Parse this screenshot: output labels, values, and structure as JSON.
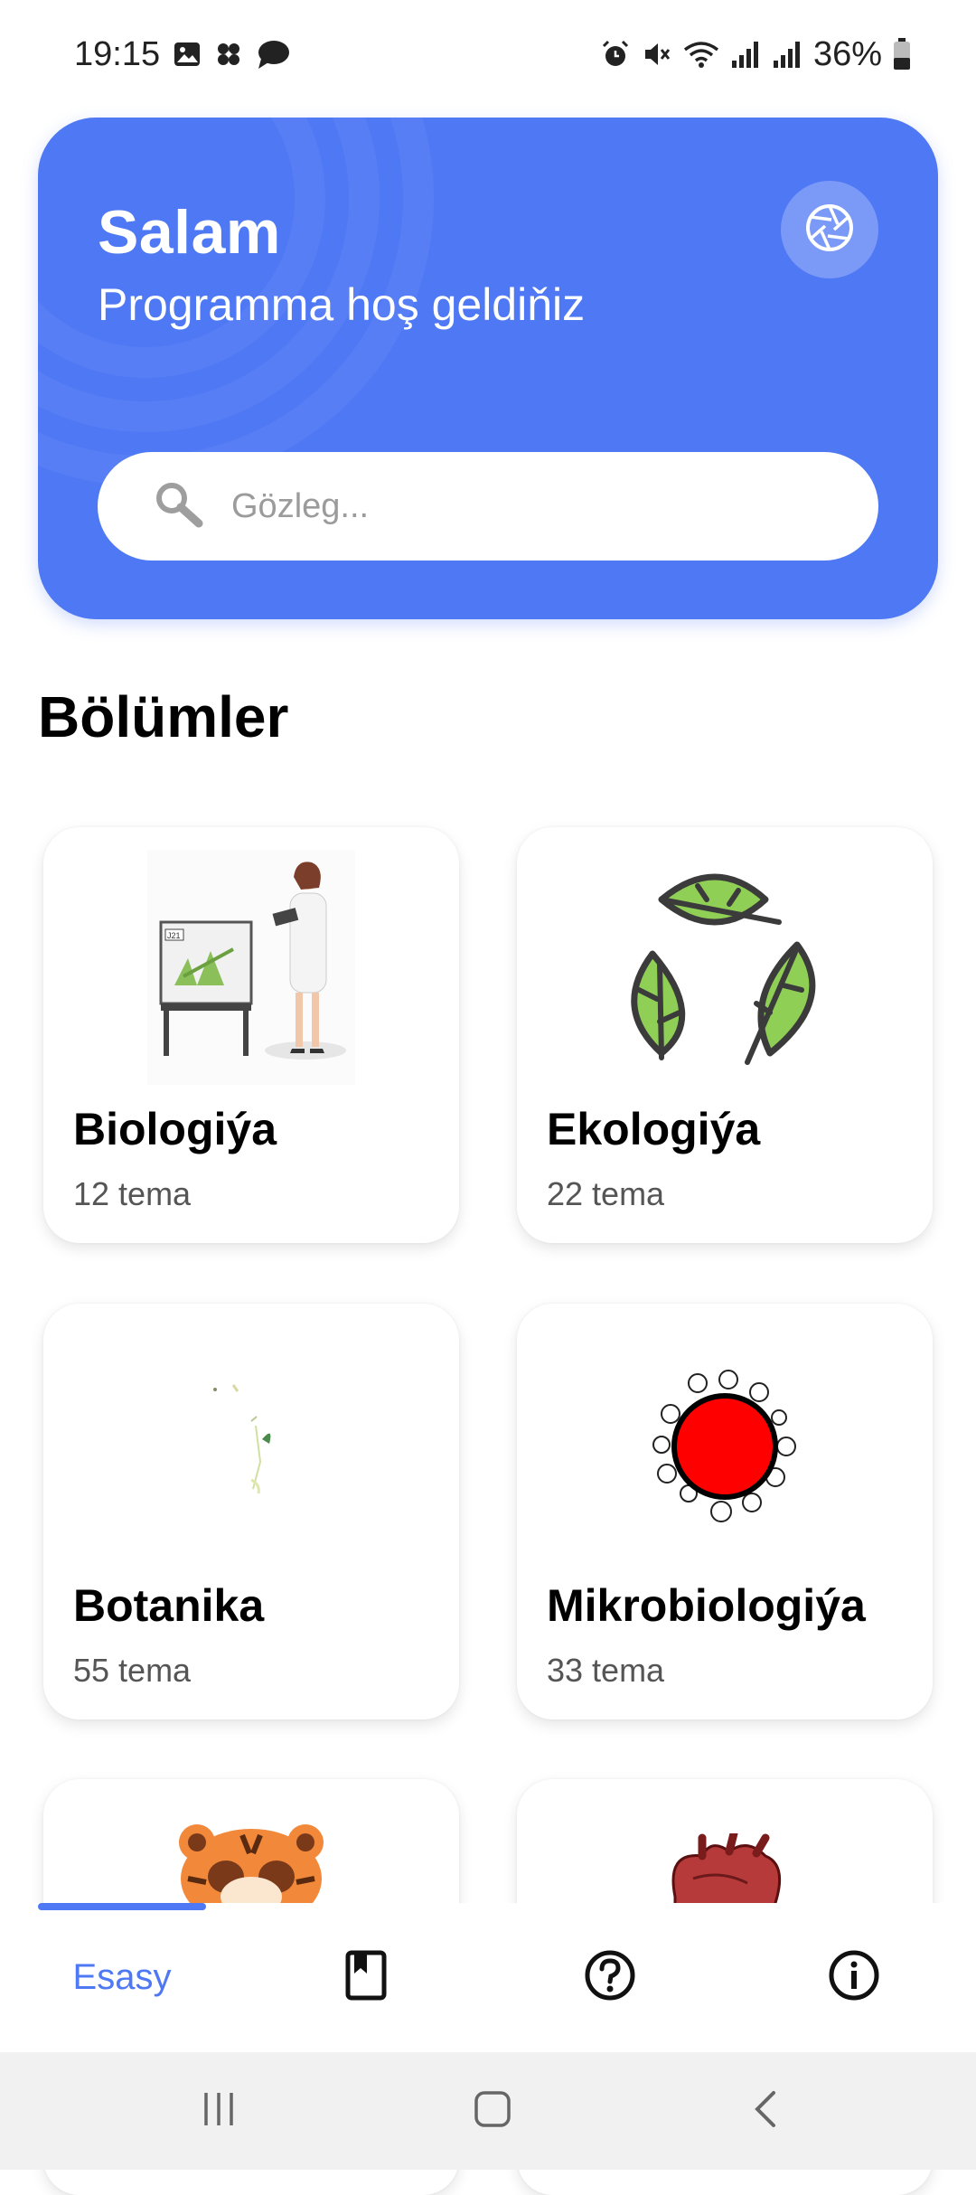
{
  "status_bar": {
    "time": "19:15",
    "battery": "36%",
    "left_icons": [
      "gallery-icon",
      "pinwheel-icon",
      "chat-bubble-icon"
    ],
    "right_icons": [
      "alarm-icon",
      "mute-icon",
      "wifi-icon",
      "signal-icon",
      "signal-icon",
      "battery-icon"
    ]
  },
  "header": {
    "title": "Salam",
    "subtitle": "Programma hoş geldiňiz",
    "settings_icon": "aperture-icon",
    "accent_color": "#4f78f4",
    "search": {
      "placeholder": "Gözleg...",
      "value": ""
    }
  },
  "section": {
    "title": "Bölümler"
  },
  "categories": [
    {
      "title": "Biologiýa",
      "count": "12 tema",
      "icon": "scientist-illustration"
    },
    {
      "title": "Ekologiýa",
      "count": "22 tema",
      "icon": "recycle-leaves-icon"
    },
    {
      "title": "Botanika",
      "count": "55 tema",
      "icon": "plant-sprout-illustration"
    },
    {
      "title": "Mikrobiologiýa",
      "count": "33 tema",
      "icon": "microbe-icon"
    },
    {
      "title": "",
      "count": "",
      "icon": "tiger-illustration"
    },
    {
      "title": "",
      "count": "",
      "icon": "heart-organ-illustration"
    }
  ],
  "bottom_nav": {
    "items": [
      {
        "label": "Esasy",
        "active": true
      },
      {
        "icon": "bookmark-book-icon"
      },
      {
        "icon": "help-circle-icon"
      },
      {
        "icon": "info-circle-icon"
      }
    ]
  },
  "system_nav": [
    "recent-apps-icon",
    "home-icon",
    "back-icon"
  ]
}
